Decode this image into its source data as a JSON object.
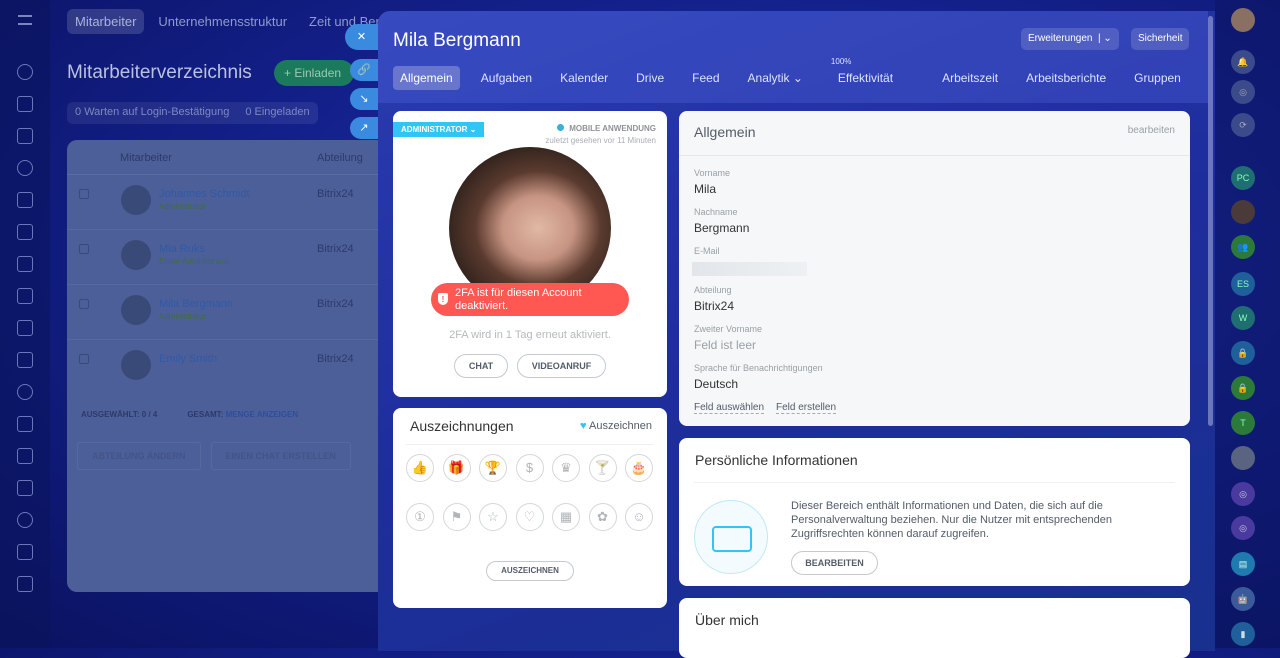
{
  "background": {
    "topnav": [
      "Mitarbeiter",
      "Unternehmensstruktur",
      "Zeit und Berichte"
    ],
    "title": "Mitarbeiterverzeichnis",
    "invite": "+ Einladen",
    "filters": [
      {
        "count": "0",
        "label": "Warten auf Login-Bestätigung"
      },
      {
        "count": "0",
        "label": "Eingeladen"
      }
    ],
    "columns": [
      "Mitarbeiter",
      "Abteilung"
    ],
    "rows": [
      {
        "name": "Johannes Schmidt",
        "role": "Administrator",
        "dept": "Bitrix24"
      },
      {
        "name": "Mia Ruks",
        "role": "Erster Administrator",
        "dept": "Bitrix24"
      },
      {
        "name": "Mila Bergmann",
        "role": "Administrator",
        "dept": "Bitrix24"
      },
      {
        "name": "Emily Smith",
        "role": "",
        "dept": "Bitrix24"
      }
    ],
    "selected_label": "AUSGEWÄHLT:",
    "selected_value": "0 / 4",
    "total_label": "GESAMT:",
    "total_link": "MENGE ANZEIGEN",
    "actions": [
      "ABTEILUNG ÄNDERN",
      "EINEN CHAT ERSTELLEN"
    ]
  },
  "panel": {
    "title": "Mila Bergmann",
    "extensions": "Erweiterungen",
    "security": "Sicherheit",
    "tabs": [
      "Allgemein",
      "Aufgaben",
      "Kalender",
      "Drive",
      "Feed",
      "Analytik ⌄",
      "Effektivität",
      "Arbeitszeit",
      "Arbeitsberichte",
      "Gruppen"
    ],
    "efficiency_value": "100%",
    "profile": {
      "role_badge": "ADMINISTRATOR ⌄",
      "status": "MOBILE ANWENDUNG",
      "last_seen": "zuletzt gesehen vor 11 Minuten",
      "twofa_warning": "2FA ist für diesen Account deaktiviert.",
      "twofa_note": "2FA wird in 1 Tag erneut aktiviert.",
      "chat": "CHAT",
      "video": "VIDEOANRUF"
    },
    "awards": {
      "title": "Auszeichnungen",
      "link": "Auszeichnen",
      "button": "AUSZEICHNEN",
      "icons": [
        "thumbs-up",
        "gift",
        "trophy",
        "money-bag",
        "crown",
        "cocktail",
        "cake",
        "number-one",
        "flag",
        "star",
        "heart",
        "calendar",
        "flower",
        "smile"
      ]
    },
    "general": {
      "title": "Allgemein",
      "edit": "bearbeiten",
      "fields": [
        {
          "label": "Vorname",
          "value": "Mila"
        },
        {
          "label": "Nachname",
          "value": "Bergmann"
        },
        {
          "label": "E-Mail",
          "value": ""
        },
        {
          "label": "Abteilung",
          "value": "Bitrix24"
        },
        {
          "label": "Zweiter Vorname",
          "value": "Feld ist leer"
        },
        {
          "label": "Sprache für Benachrichtigungen",
          "value": "Deutsch"
        }
      ],
      "select_field": "Feld auswählen",
      "create_field": "Feld erstellen"
    },
    "personal": {
      "title": "Persönliche Informationen",
      "text": "Dieser Bereich enthält Informationen und Daten, die sich auf die Personalverwaltung beziehen. Nur die Nutzer mit entsprechenden Zugriffsrechten können darauf zugreifen.",
      "button": "BEARBEITEN"
    },
    "about": {
      "title": "Über mich"
    }
  },
  "right_bar": {
    "avatars": [
      "PC",
      "ES",
      "W",
      "T"
    ]
  }
}
